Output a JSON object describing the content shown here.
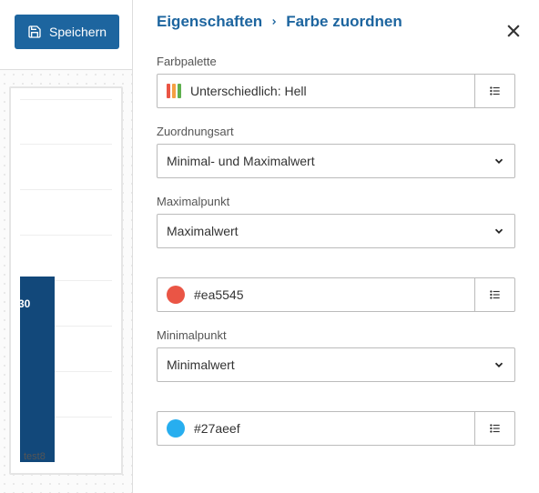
{
  "toolbar": {
    "save_label": "Speichern"
  },
  "breadcrumb": {
    "parent": "Eigenschaften",
    "current": "Farbe zuordnen"
  },
  "labels": {
    "palette": "Farbpalette",
    "mapping": "Zuordnungsart",
    "maxpoint": "Maximalpunkt",
    "minpoint": "Minimalpunkt"
  },
  "palette": {
    "name": "Unterschiedlich: Hell",
    "swatch": [
      "#ea5545",
      "#f4a043",
      "#5fb04f"
    ]
  },
  "mapping": {
    "value": "Minimal- und Maximalwert"
  },
  "maxpoint": {
    "type": "Maximalwert",
    "color_hex": "#ea5545"
  },
  "minpoint": {
    "type": "Minimalwert",
    "color_hex": "#27aeef"
  },
  "chart": {
    "bar_value": "30",
    "x_label": "test8"
  }
}
